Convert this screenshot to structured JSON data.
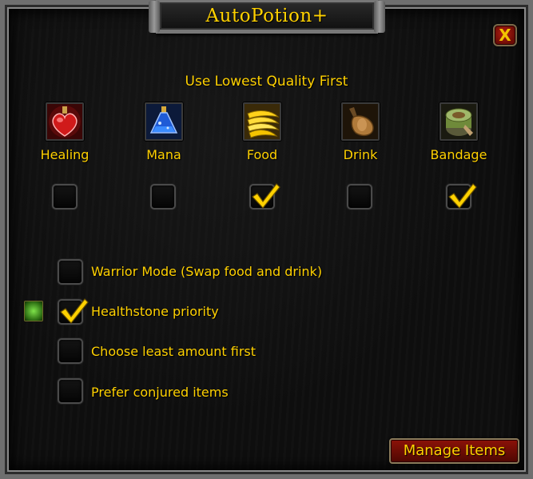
{
  "window": {
    "title": "AutoPotion+"
  },
  "close_button": {
    "label": "X"
  },
  "section": {
    "title": "Use Lowest Quality First"
  },
  "categories": [
    {
      "label": "Healing",
      "icon": "healing-potion-icon",
      "checked": false
    },
    {
      "label": "Mana",
      "icon": "mana-potion-icon",
      "checked": false
    },
    {
      "label": "Food",
      "icon": "banana-food-icon",
      "checked": true
    },
    {
      "label": "Drink",
      "icon": "drink-flask-icon",
      "checked": false
    },
    {
      "label": "Bandage",
      "icon": "bandage-icon",
      "checked": true
    }
  ],
  "options": [
    {
      "label": "Warrior Mode (Swap food and drink)",
      "checked": false
    },
    {
      "label": "Healthstone priority",
      "checked": true,
      "icon": "healthstone-icon"
    },
    {
      "label": "Choose least amount first",
      "checked": false
    },
    {
      "label": "Prefer conjured items",
      "checked": false
    }
  ],
  "manage_button": {
    "label": "Manage Items"
  },
  "colors": {
    "label_gold": "#ffd100",
    "button_red": "#8c1208",
    "frame_grey": "#6f6f6f"
  }
}
